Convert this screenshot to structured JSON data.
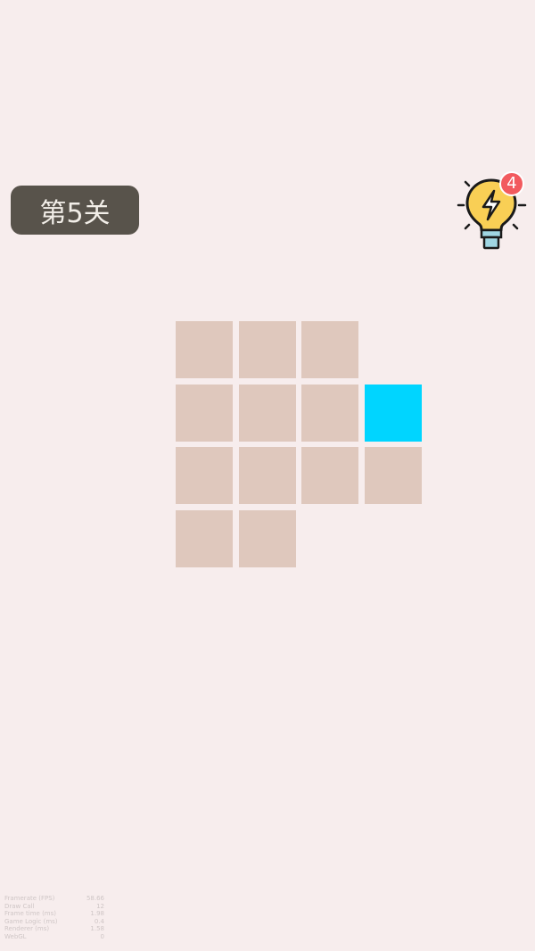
{
  "level": {
    "label": "第5关"
  },
  "hint": {
    "icon": "lightbulb-bolt-icon",
    "badge_count": "4"
  },
  "board": {
    "cells": [
      {
        "row": 0,
        "col": 0,
        "state": "empty"
      },
      {
        "row": 0,
        "col": 1,
        "state": "empty"
      },
      {
        "row": 0,
        "col": 2,
        "state": "empty"
      },
      {
        "row": 1,
        "col": 0,
        "state": "empty"
      },
      {
        "row": 1,
        "col": 1,
        "state": "empty"
      },
      {
        "row": 1,
        "col": 2,
        "state": "empty"
      },
      {
        "row": 1,
        "col": 3,
        "state": "active"
      },
      {
        "row": 2,
        "col": 0,
        "state": "empty"
      },
      {
        "row": 2,
        "col": 1,
        "state": "empty"
      },
      {
        "row": 2,
        "col": 2,
        "state": "empty"
      },
      {
        "row": 2,
        "col": 3,
        "state": "empty"
      },
      {
        "row": 3,
        "col": 0,
        "state": "empty"
      },
      {
        "row": 3,
        "col": 1,
        "state": "empty"
      }
    ],
    "colors": {
      "empty": "#dfc8bd",
      "active": "#00d5ff"
    }
  },
  "stats": [
    {
      "label": "Framerate (FPS)",
      "value": "58.66"
    },
    {
      "label": "Draw Call",
      "value": "12"
    },
    {
      "label": "Frame time (ms)",
      "value": "1.98"
    },
    {
      "label": "Game Logic (ms)",
      "value": "0.4"
    },
    {
      "label": "Renderer (ms)",
      "value": "1.58"
    },
    {
      "label": "WebGL",
      "value": "0"
    }
  ]
}
